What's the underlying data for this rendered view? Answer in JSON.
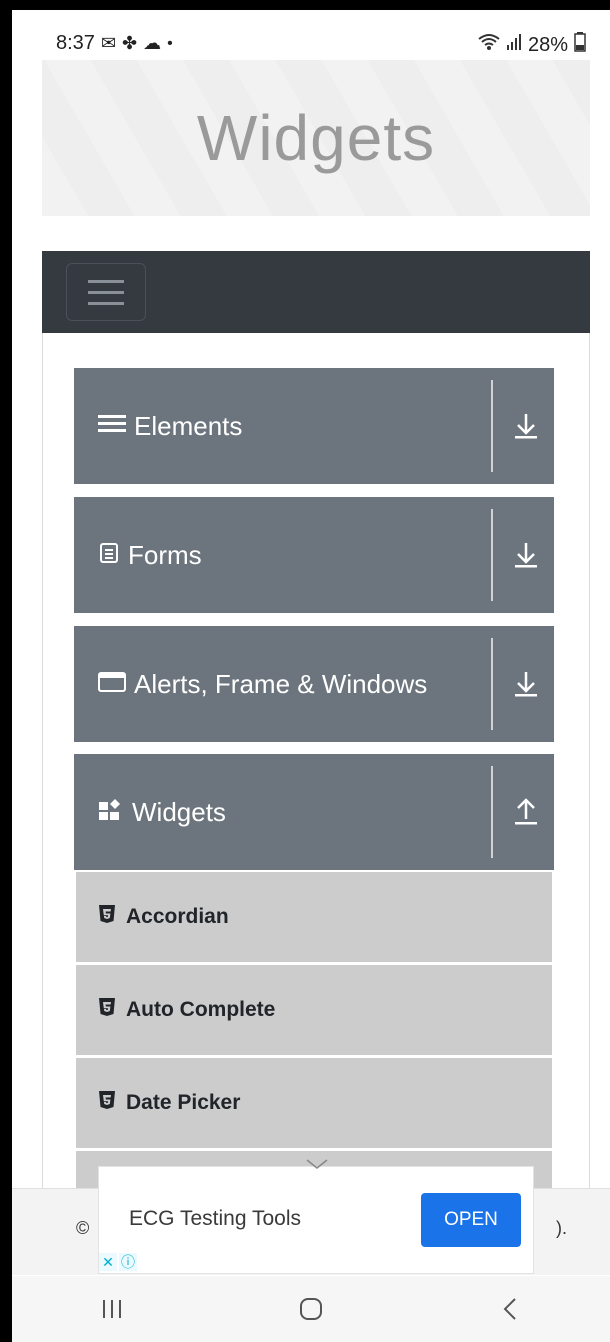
{
  "status": {
    "time": "8:37",
    "battery": "28%"
  },
  "header": {
    "title": "Widgets"
  },
  "menu": {
    "groups": [
      {
        "label": "Elements",
        "icon": "list-icon",
        "expanded": false
      },
      {
        "label": "Forms",
        "icon": "document-icon",
        "expanded": false
      },
      {
        "label": "Alerts, Frame & Windows",
        "icon": "window-icon",
        "expanded": false
      },
      {
        "label": "Widgets",
        "icon": "widgets-icon",
        "expanded": true
      }
    ],
    "widget_items": [
      "Accordian",
      "Auto Complete",
      "Date Picker"
    ]
  },
  "ad": {
    "title": "ECG Testing Tools",
    "button": "OPEN"
  },
  "footer": {
    "left": "©",
    "right": ")."
  },
  "colors": {
    "navbar": "#343a40",
    "group": "#6c757d",
    "item": "#cccccc",
    "ad_button": "#1a73e8"
  }
}
